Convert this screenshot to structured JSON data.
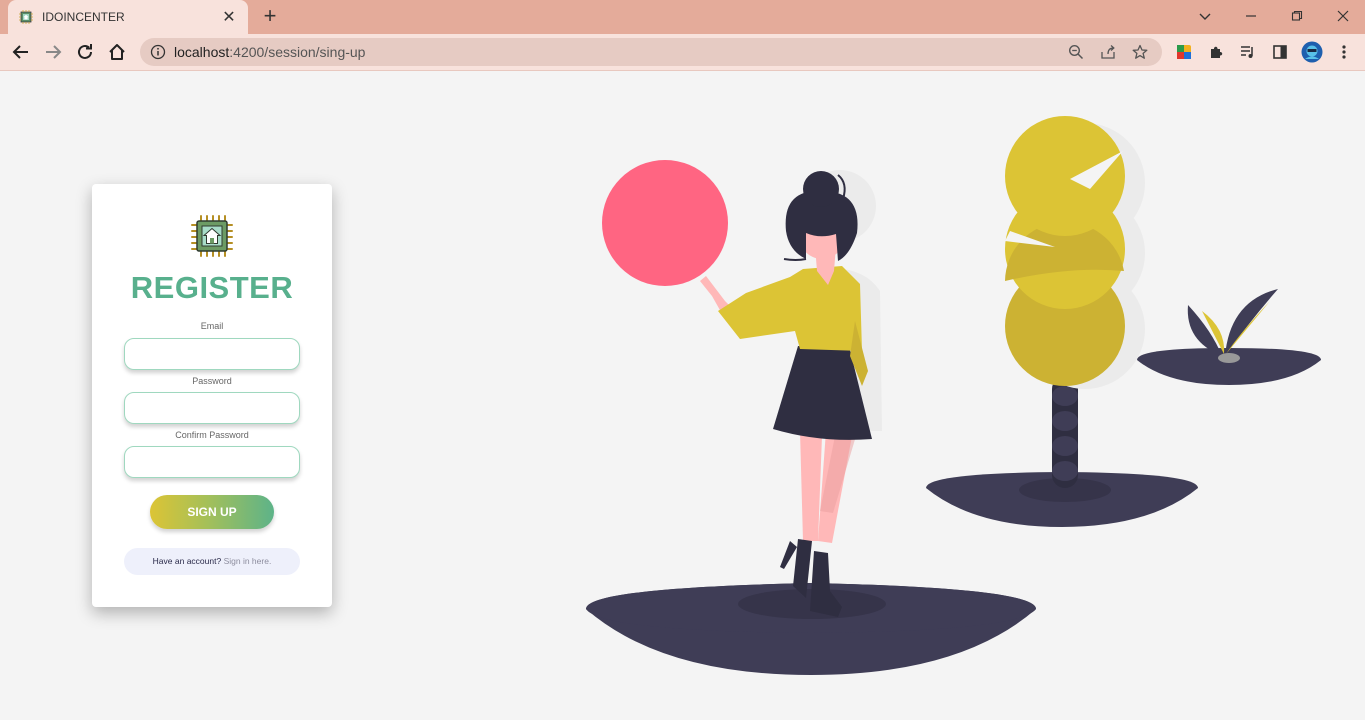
{
  "browser": {
    "tab_title": "IDOINCENTER",
    "url_host": "localhost",
    "url_path": ":4200/session/sing-up"
  },
  "form": {
    "title": "REGISTER",
    "email_label": "Email",
    "password_label": "Password",
    "confirm_label": "Confirm Password",
    "email_value": "",
    "password_value": "",
    "confirm_value": "",
    "signup_label": "SIGN UP",
    "have_account_text": "Have an account?",
    "signin_link": "Sign in here."
  },
  "colors": {
    "accent_green": "#58b08d",
    "tab_bar": "#e4ab9a",
    "toolbar": "#f8e2dc",
    "illustration_dark": "#3f3d56",
    "illustration_yellow": "#dcc435",
    "illustration_pink": "#ff6582"
  }
}
